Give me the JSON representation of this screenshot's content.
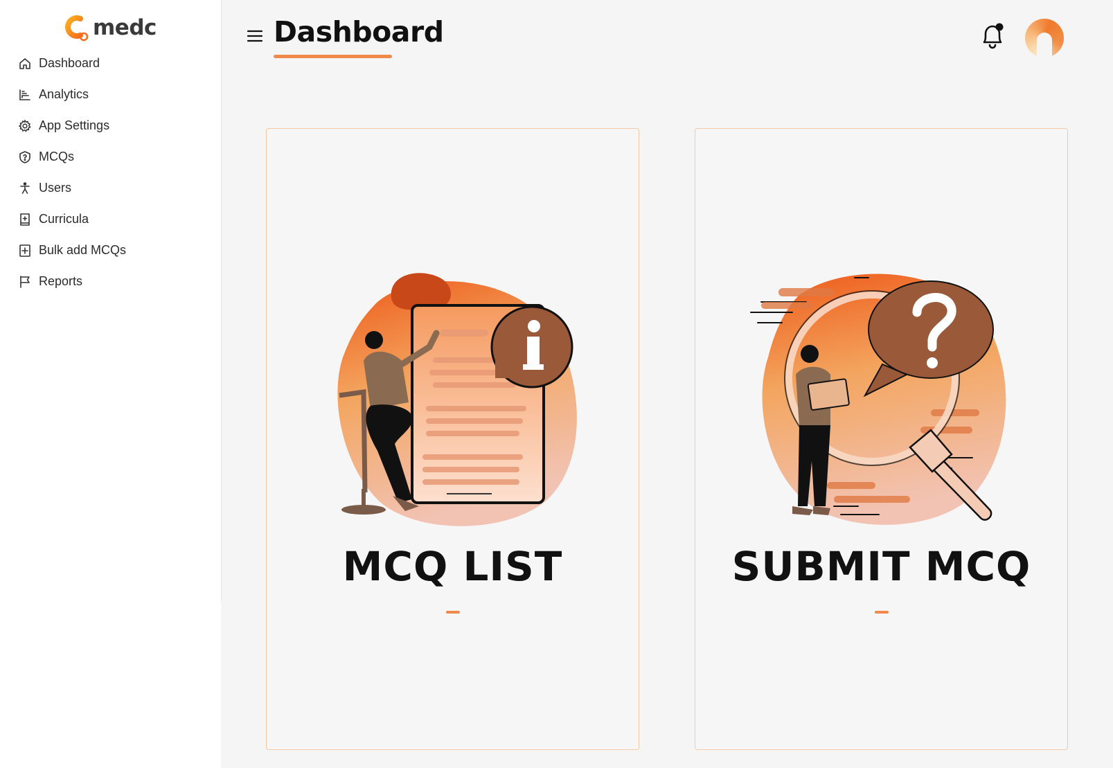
{
  "app": {
    "name": "medc"
  },
  "colors": {
    "accent": "#f08a4b",
    "card_border": "#f5c9a6",
    "background": "#f5f5f5"
  },
  "sidebar": {
    "items": [
      {
        "label": "Dashboard",
        "icon": "home-icon"
      },
      {
        "label": "Analytics",
        "icon": "bar-chart-icon"
      },
      {
        "label": "App Settings",
        "icon": "gear-icon"
      },
      {
        "label": "MCQs",
        "icon": "shield-question-icon"
      },
      {
        "label": "Users",
        "icon": "person-icon"
      },
      {
        "label": "Curricula",
        "icon": "book-plus-icon"
      },
      {
        "label": "Bulk add MCQs",
        "icon": "square-plus-icon"
      },
      {
        "label": "Reports",
        "icon": "flag-icon"
      }
    ]
  },
  "header": {
    "title": "Dashboard",
    "menu_icon": "hamburger-icon",
    "notification_icon": "bell-icon",
    "avatar_icon": "avatar-icon"
  },
  "cards": [
    {
      "title": "MCQ LIST",
      "illustration": "document-info-illustration"
    },
    {
      "title": "SUBMIT MCQ",
      "illustration": "magnifier-question-illustration"
    }
  ]
}
